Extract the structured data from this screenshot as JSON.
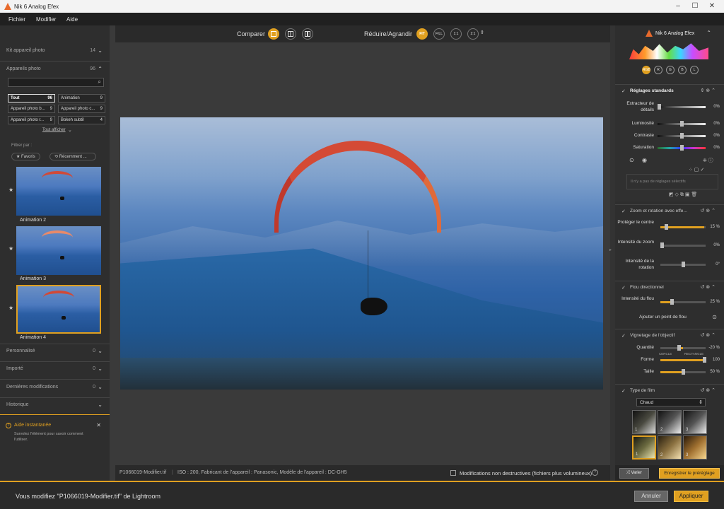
{
  "window": {
    "title": "Nik 6 Analog Efex",
    "min": "–",
    "max": "☐",
    "close": "✕"
  },
  "menu": {
    "file": "Fichier",
    "edit": "Modifier",
    "help": "Aide"
  },
  "left": {
    "cameras_kit": {
      "label": "Kit appareil photo",
      "count": "14"
    },
    "cameras": {
      "label": "Appareils photo",
      "count": "96"
    },
    "chips": [
      {
        "label": "Tout",
        "count": "96"
      },
      {
        "label": "Animation",
        "count": "9"
      },
      {
        "label": "Appareil photo b...",
        "count": "9"
      },
      {
        "label": "Appareil photo c...",
        "count": "9"
      },
      {
        "label": "Appareil photo r...",
        "count": "9"
      },
      {
        "label": "Bokeh subtil",
        "count": "4"
      }
    ],
    "show_all": "Tout afficher",
    "filter_by": "Filtrer par :",
    "favorites": "★ Favoris",
    "recent": "⟲ Récemment ...",
    "presets": [
      {
        "label": "Animation 2"
      },
      {
        "label": "Animation 3"
      },
      {
        "label": "Animation 4"
      }
    ],
    "sections": [
      {
        "label": "Personnalisé",
        "count": "0"
      },
      {
        "label": "Importé",
        "count": "0"
      },
      {
        "label": "Dernières modifications",
        "count": "0"
      },
      {
        "label": "Historique",
        "count": ""
      }
    ],
    "help": {
      "title": "Aide instantanée",
      "text": "Survolez l'élément pour savoir comment l'utiliser."
    }
  },
  "center": {
    "compare": "Comparer",
    "zoom": "Réduire/Agrandir",
    "zoom_btns": [
      "FIT",
      "FILL",
      "1:1",
      "2:1"
    ],
    "file": "P1066019-Modifier.tif",
    "exif": "ISO : 200, Fabricant de l'appareil : Panasonic, Modèle de l'appareil : DC-GH5",
    "nondestructive": "Modifications non destructives (fichiers plus volumineux)"
  },
  "right": {
    "brand": "Nik 6 Analog Efex",
    "hist_btns": [
      "RGB",
      "R",
      "G",
      "B",
      "L"
    ],
    "standard": {
      "title": "Réglages standards",
      "sliders": [
        {
          "label": "Extracteur de détails",
          "value": "0%"
        },
        {
          "label": "Luminosité",
          "value": "0%"
        },
        {
          "label": "Contraste",
          "value": "0%"
        },
        {
          "label": "Saturation",
          "value": "0%"
        }
      ],
      "selective": "Il n'y a pas de réglages sélectifs"
    },
    "zoom_rot": {
      "title": "Zoom et rotation avec effe...",
      "sliders": [
        {
          "label": "Protéger le centre",
          "value": "15 %"
        },
        {
          "label": "Intensité du zoom",
          "value": "0%"
        },
        {
          "label": "Intensité de la rotation",
          "value": "0°"
        }
      ]
    },
    "blur": {
      "title": "Flou directionnel",
      "slider": {
        "label": "Intensité du flou",
        "value": "25 %"
      },
      "add_point": "Ajouter un point de flou"
    },
    "vignette": {
      "title": "Vignetage de l'objectif",
      "amount": {
        "label": "Quantité",
        "value": "-20 %"
      },
      "shape": {
        "label": "Forme",
        "value": "100",
        "circle": "CERCLE",
        "rect": "RECTANGLE"
      },
      "size": {
        "label": "Taille",
        "value": "50 %"
      }
    },
    "film": {
      "title": "Type de film",
      "dropdown": "Chaud",
      "swatches": [
        "1",
        "2",
        "3",
        "1",
        "2",
        "3"
      ]
    },
    "vary": "Varier",
    "save_preset": "Enregistrer le préréglage"
  },
  "status": {
    "message": "Vous modifiez \"P1066019-Modifier.tif\" de Lightroom",
    "cancel": "Annuler",
    "apply": "Appliquer"
  }
}
